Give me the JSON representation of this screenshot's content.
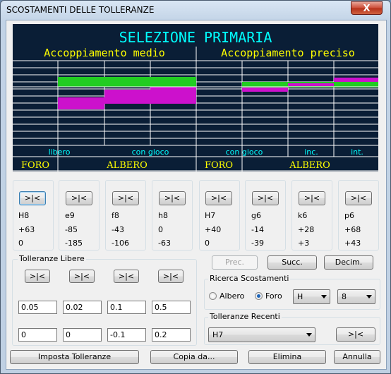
{
  "window": {
    "title": "SCOSTAMENTI DELLE TOLLERANZE",
    "close_symbol": "X"
  },
  "diagram": {
    "heading": "SELEZIONE PRIMARIA",
    "left_group": "Accoppiamento medio",
    "right_group": "Accoppiamento preciso",
    "fit_labels": [
      "libero",
      "con gioco",
      "con gioco",
      "inc.",
      "int."
    ],
    "bottom_labels": [
      "FORO",
      "ALBERO",
      "FORO",
      "ALBERO"
    ],
    "colors": {
      "background": "#0a1e36",
      "title": "#00ffff",
      "group": "#ffff00",
      "hole_zone": "#22cc22",
      "shaft_zone": "#cc11cc",
      "label": "#00ffff"
    }
  },
  "columns": [
    {
      "button": ">|<",
      "name": "H8",
      "upper": "+63",
      "lower": "0"
    },
    {
      "button": ">|<",
      "name": "e9",
      "upper": "-85",
      "lower": "-185"
    },
    {
      "button": ">|<",
      "name": "f8",
      "upper": "-43",
      "lower": "-106"
    },
    {
      "button": ">|<",
      "name": "h8",
      "upper": "0",
      "lower": "-63"
    },
    {
      "button": ">|<",
      "name": "H7",
      "upper": "+40",
      "lower": "0"
    },
    {
      "button": ">|<",
      "name": "g6",
      "upper": "-14",
      "lower": "-39"
    },
    {
      "button": ">|<",
      "name": "k6",
      "upper": "+28",
      "lower": "+3"
    },
    {
      "button": ">|<",
      "name": "p6",
      "upper": "+68",
      "lower": "+43"
    }
  ],
  "free_tolerances": {
    "title": "Tolleranze Libere",
    "buttons": [
      ">|<",
      ">|<",
      ">|<",
      ">|<"
    ],
    "upper": [
      "0.05",
      "0.02",
      "0.1",
      "0.5"
    ],
    "lower": [
      "0",
      "0",
      "-0.1",
      "0.2"
    ]
  },
  "nav": {
    "prev": "Prec.",
    "next": "Succ.",
    "decimals": "Decim."
  },
  "search": {
    "title": "Ricerca Scostamenti",
    "option_shaft": "Albero",
    "option_hole": "Foro",
    "selected": "Foro",
    "letter": "H",
    "grade": "8"
  },
  "recent": {
    "title": "Tolleranze Recenti",
    "value": "H7",
    "button": ">|<"
  },
  "footer": {
    "set": "Imposta Tolleranze",
    "copy": "Copia da...",
    "delete": "Elimina",
    "cancel": "Annulla"
  }
}
